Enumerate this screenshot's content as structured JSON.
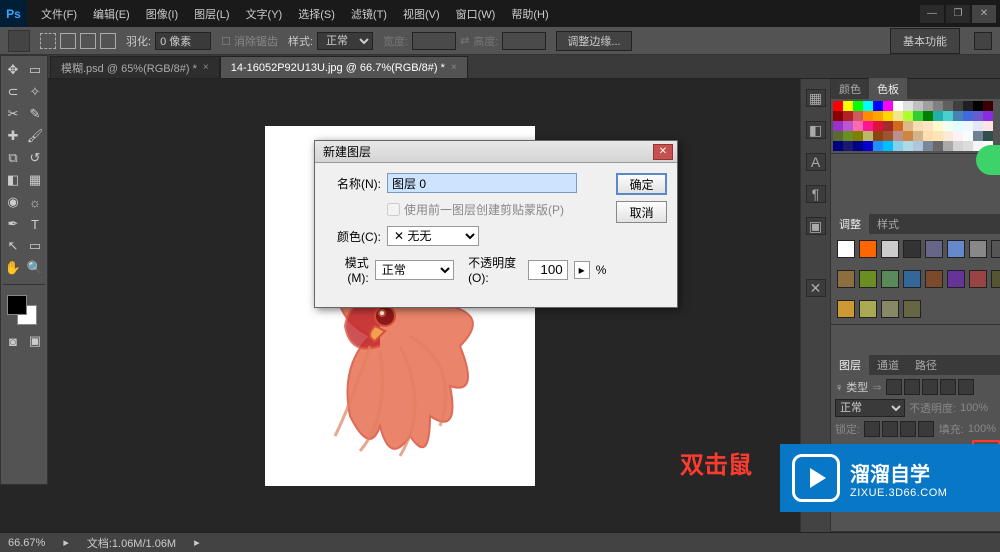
{
  "menu": {
    "file": "文件(F)",
    "edit": "编辑(E)",
    "image": "图像(I)",
    "layer": "图层(L)",
    "type": "文字(Y)",
    "select": "选择(S)",
    "filter": "滤镜(T)",
    "view": "视图(V)",
    "window": "窗口(W)",
    "help": "帮助(H)"
  },
  "options": {
    "feather_label": "羽化:",
    "feather_value": "0 像素",
    "antialias": "消除锯齿",
    "style_label": "样式:",
    "style_value": "正常",
    "width_label": "宽度:",
    "height_label": "高度:",
    "refine_edge": "调整边缘...",
    "essentials": "基本功能"
  },
  "tabs": [
    {
      "label": "模糊.psd @ 65%(RGB/8#) *",
      "active": false
    },
    {
      "label": "14-16052P92U13U.jpg @ 66.7%(RGB/8#) *",
      "active": true
    }
  ],
  "dialog": {
    "title": "新建图层",
    "name_label": "名称(N):",
    "name_value": "图层 0",
    "clip_label": "使用前一图层创建剪贴蒙版(P)",
    "color_label": "颜色(C):",
    "color_value": "无",
    "color_x": "✕",
    "mode_label": "模式(M):",
    "mode_value": "正常",
    "opacity_label": "不透明度(O):",
    "opacity_value": "100",
    "opacity_unit": "%",
    "ok": "确定",
    "cancel": "取消"
  },
  "panels": {
    "color_tab": "颜色",
    "swatches_tab": "色板",
    "adjust_tab": "调整",
    "styles_tab": "样式",
    "layers_tab": "图层",
    "channels_tab": "通道",
    "paths_tab": "路径",
    "kind_label": "♀ 类型",
    "blend_value": "正常",
    "opacity_label": "不透明度:",
    "opacity_value": "100%",
    "lock_label": "锁定:",
    "fill_label": "填充:",
    "fill_value": "100%"
  },
  "status": {
    "zoom": "66.67%",
    "doc": "文档:1.06M/1.06M"
  },
  "annotation": "双击鼠",
  "watermark": {
    "name": "溜溜自学",
    "url": "ZIXUE.3D66.COM"
  },
  "swatch_colors": [
    "#ff0000",
    "#ffff00",
    "#00ff00",
    "#00ffff",
    "#0000ff",
    "#ff00ff",
    "#ffffff",
    "#e0e0e0",
    "#c0c0c0",
    "#a0a0a0",
    "#808080",
    "#606060",
    "#404040",
    "#202020",
    "#000000",
    "#3a0000",
    "#8b0000",
    "#b22222",
    "#cd5c5c",
    "#ff8c00",
    "#ffa500",
    "#ffd700",
    "#f0e68c",
    "#adff2f",
    "#32cd32",
    "#008000",
    "#20b2aa",
    "#48d1cc",
    "#4682b4",
    "#4169e1",
    "#6a5acd",
    "#8a2be2",
    "#9932cc",
    "#ba55d3",
    "#ff69b4",
    "#ff1493",
    "#dc143c",
    "#a52a2a",
    "#d2691e",
    "#deb887",
    "#f5deb3",
    "#ffe4c4",
    "#fffacd",
    "#f0fff0",
    "#e0ffff",
    "#f0f8ff",
    "#e6e6fa",
    "#ffe4e1",
    "#556b2f",
    "#6b8e23",
    "#808000",
    "#bdb76b",
    "#8b4513",
    "#a0522d",
    "#bc8f8f",
    "#cd853f",
    "#d2b48c",
    "#ffdead",
    "#ffe4b5",
    "#faebd7",
    "#fff0f5",
    "#f5fffa",
    "#708090",
    "#2f4f4f",
    "#000080",
    "#191970",
    "#00008b",
    "#0000cd",
    "#1e90ff",
    "#00bfff",
    "#87ceeb",
    "#add8e6",
    "#b0c4de",
    "#778899",
    "#696969",
    "#a9a9a9",
    "#d3d3d3",
    "#dcdcdc",
    "#f5f5f5",
    "#fffafa"
  ],
  "adjust_colors1": [
    "#ffffff",
    "#ff6600",
    "#cccccc",
    "#333333",
    "#666688",
    "#6688cc",
    "#888888",
    "#555555"
  ],
  "adjust_colors2": [
    "#8b6f3e",
    "#6b8e23",
    "#5a8a5a",
    "#336699",
    "#7a4a2a",
    "#663399",
    "#994444",
    "#555533"
  ],
  "adjust_colors3": [
    "#cc9933",
    "#aaaa55",
    "#888866",
    "#666644"
  ]
}
